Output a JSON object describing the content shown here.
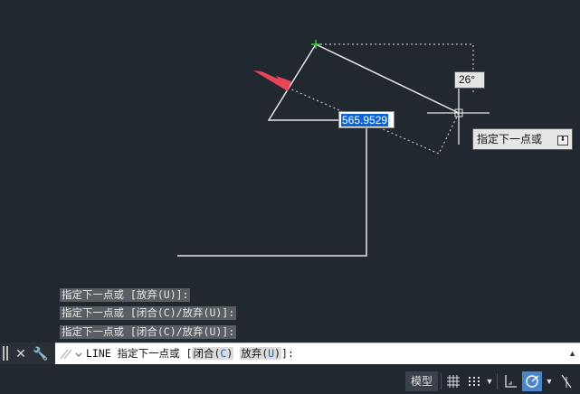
{
  "canvas": {
    "dynamic_input_value": "565.9529",
    "angle_tooltip": "26°",
    "prompt_tooltip": "指定下一点或"
  },
  "history": [
    "指定下一点或 [放弃(U)]:",
    "指定下一点或 [闭合(C)/放弃(U)]:",
    "指定下一点或 [闭合(C)/放弃(U)]:"
  ],
  "command_line": {
    "prefix": "LINE 指定下一点或 [",
    "option1": "闭合(C)",
    "option1_label": "闭合(",
    "option1_key": "C",
    "option2_label": "放弃(",
    "option2_key": "U",
    "close_paren": ")",
    "suffix": "]:"
  },
  "statusbar": {
    "model_label": "模型"
  },
  "colors": {
    "background": "#212830",
    "geometry": "#e6e6e6",
    "arrow": "#e8455a",
    "highlight": "#0a64d8",
    "polar_on": "#4a86c8"
  }
}
